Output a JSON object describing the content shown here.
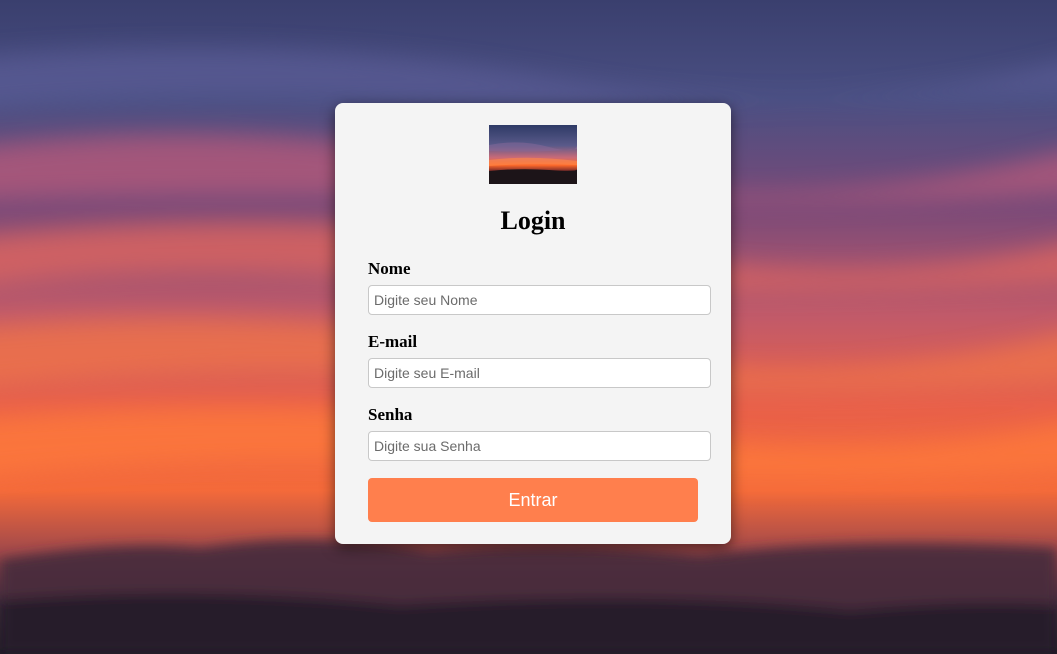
{
  "login": {
    "title": "Login",
    "fields": [
      {
        "label": "Nome",
        "placeholder": "Digite seu Nome"
      },
      {
        "label": "E-mail",
        "placeholder": "Digite seu E-mail"
      },
      {
        "label": "Senha",
        "placeholder": "Digite sua Senha"
      }
    ],
    "submit_label": "Entrar"
  },
  "colors": {
    "card_background": "#f4f4f4",
    "button_background": "#ff7f4d",
    "button_text": "#ffffff"
  }
}
